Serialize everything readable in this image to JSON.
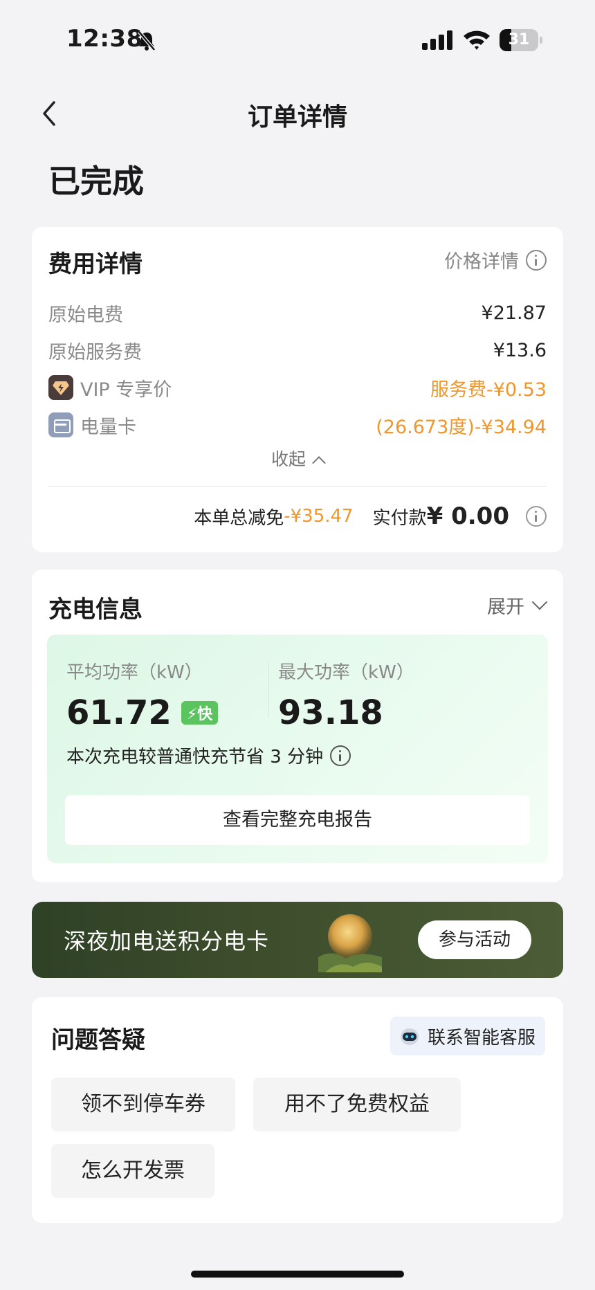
{
  "status_bar": {
    "time": "12:38",
    "battery": "31",
    "battery_level": 0.31
  },
  "nav": {
    "title": "订单详情"
  },
  "order_status": "已完成",
  "fee_card": {
    "title": "费用详情",
    "price_detail_label": "价格详情",
    "rows": [
      {
        "label": "原始电费",
        "value": "¥21.87"
      },
      {
        "label": "原始服务费",
        "value": "¥13.6"
      },
      {
        "label": "VIP 专享价",
        "value": "服务费-¥0.53"
      },
      {
        "label": "电量卡",
        "value": "(26.673度)-¥34.94"
      }
    ],
    "collapse_label": "收起",
    "total_discount_label": "本单总减免",
    "total_discount_value": "-¥35.47",
    "paid_label": "实付款",
    "paid_value": "¥ 0.00"
  },
  "charge_card": {
    "title": "充电信息",
    "expand_label": "展开",
    "avg_power_label": "平均功率（kW）",
    "avg_power_value": "61.72",
    "fast_badge": "⚡快",
    "max_power_label": "最大功率（kW）",
    "max_power_value": "93.18",
    "save_text": "本次充电较普通快充节省 3 分钟",
    "report_button": "查看完整充电报告"
  },
  "banner": {
    "text": "深夜加电送积分电卡",
    "button": "参与活动"
  },
  "qa_card": {
    "title": "问题答疑",
    "service_button": "联系智能客服",
    "chips": [
      "领不到停车券",
      "用不了免费权益",
      "怎么开发票"
    ]
  },
  "colors": {
    "accent_orange": "#f0962a",
    "fast_green": "#5bc45e",
    "background": "#f3f3f5"
  }
}
